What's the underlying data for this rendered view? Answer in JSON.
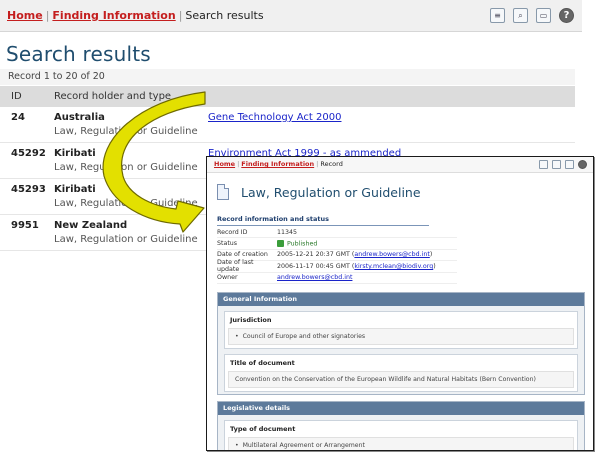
{
  "breadcrumb": {
    "home": "Home",
    "finding": "Finding Information",
    "current": "Search results"
  },
  "toolbar": {
    "icons": [
      "report-icon",
      "search-report-icon",
      "print-icon",
      "help-icon"
    ]
  },
  "page": {
    "title": "Search results",
    "record_count": "Record 1 to 20 of 20"
  },
  "table": {
    "headers": {
      "id": "ID",
      "holder": "Record holder and type"
    },
    "rows": [
      {
        "id": "24",
        "country": "Australia",
        "type": "Law, Regulation or Guideline",
        "title": "Gene Technology Act 2000"
      },
      {
        "id": "45292",
        "country": "Kiribati",
        "type": "Law, Regulation or Guideline",
        "title": "Environment Act 1999 - as ammended"
      },
      {
        "id": "45293",
        "country": "Kiribati",
        "type": "Law, Regulation or Guideline",
        "title": ""
      },
      {
        "id": "9951",
        "country": "New Zealand",
        "type": "Law, Regulation or Guideline",
        "title": ""
      }
    ]
  },
  "arrow_color": "#e3e000",
  "inset": {
    "breadcrumb": {
      "home": "Home",
      "finding": "Finding Information",
      "current": "Record"
    },
    "title": "Law, Regulation or Guideline",
    "record_info_heading": "Record information and status",
    "record_info": {
      "record_id_label": "Record ID",
      "record_id": "11345",
      "status_label": "Status",
      "status": "Published",
      "creation_label": "Date of creation",
      "creation_date": "2005-12-21 20:37 GMT",
      "creation_by": "andrew.bowers@cbd.int",
      "update_label": "Date of last update",
      "update_date": "2006-11-17 00:45 GMT",
      "update_by": "kirsty.mclean@biodiv.org",
      "owner_label": "Owner",
      "owner": "andrew.bowers@cbd.int"
    },
    "general": {
      "heading": "General Information",
      "jurisdiction_label": "Jurisdiction",
      "jurisdiction": "Council of Europe and other signatories",
      "doc_title_label": "Title of document",
      "doc_title": "Convention on the Conservation of the European Wildlife and Natural Habitats (Bern Convention)"
    },
    "legislative": {
      "heading": "Legislative details",
      "type_label": "Type of document",
      "type": "Multilateral Agreement or Arrangement"
    }
  }
}
